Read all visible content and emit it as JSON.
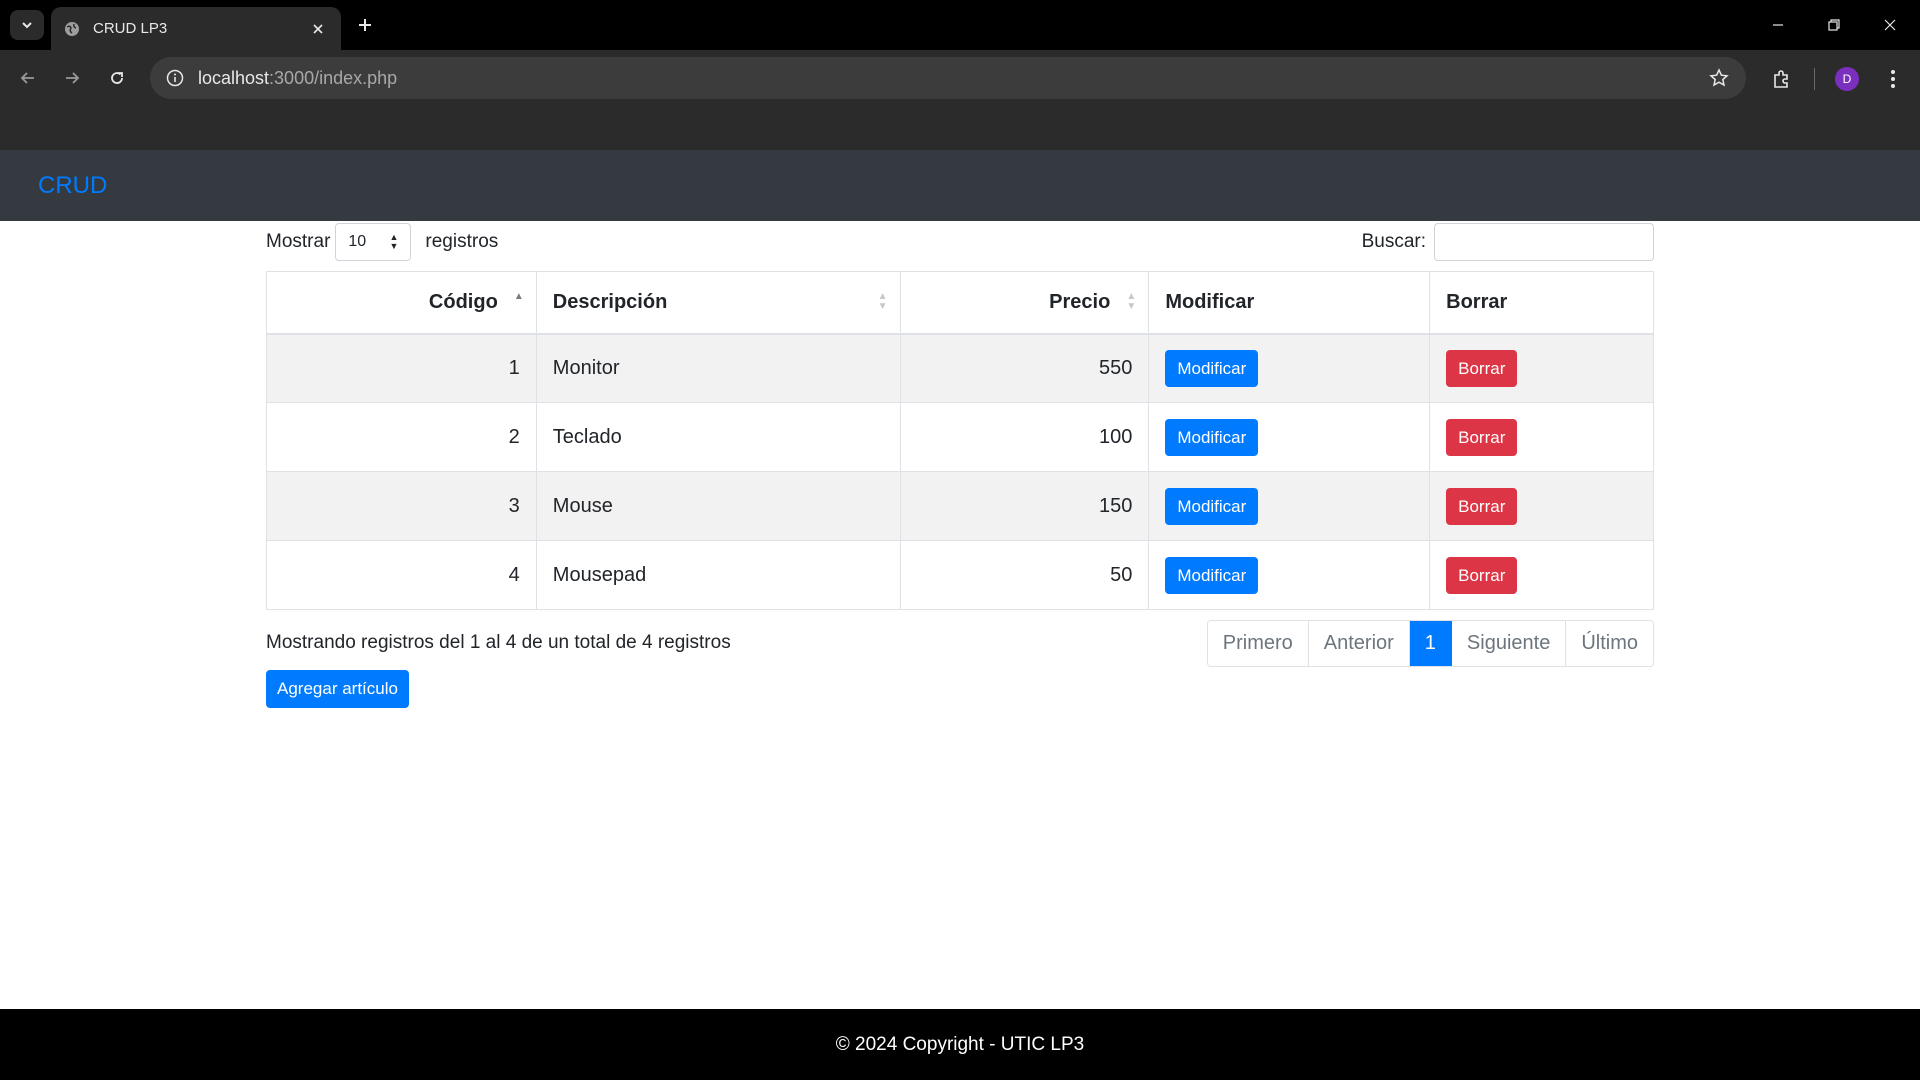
{
  "browser": {
    "tab_title": "CRUD LP3",
    "url_host": "localhost",
    "url_path": ":3000/index.php",
    "profile_initial": "D"
  },
  "navbar": {
    "brand": "CRUD"
  },
  "controls": {
    "show_label": "Mostrar",
    "page_size": "10",
    "records_label": "registros",
    "search_label": "Buscar:",
    "search_value": ""
  },
  "table": {
    "headers": {
      "codigo": "Código",
      "descripcion": "Descripción",
      "precio": "Precio",
      "modificar": "Modificar",
      "borrar": "Borrar"
    },
    "rows": [
      {
        "codigo": "1",
        "descripcion": "Monitor",
        "precio": "550",
        "modificar": "Modificar",
        "borrar": "Borrar"
      },
      {
        "codigo": "2",
        "descripcion": "Teclado",
        "precio": "100",
        "modificar": "Modificar",
        "borrar": "Borrar"
      },
      {
        "codigo": "3",
        "descripcion": "Mouse",
        "precio": "150",
        "modificar": "Modificar",
        "borrar": "Borrar"
      },
      {
        "codigo": "4",
        "descripcion": "Mousepad",
        "precio": "50",
        "modificar": "Modificar",
        "borrar": "Borrar"
      }
    ]
  },
  "info": "Mostrando registros del 1 al 4 de un total de 4 registros",
  "pagination": {
    "first": "Primero",
    "previous": "Anterior",
    "current": "1",
    "next": "Siguiente",
    "last": "Último"
  },
  "add_button": "Agregar artículo",
  "footer": "© 2024 Copyright - UTIC LP3",
  "colors": {
    "primary": "#007bff",
    "danger": "#dc3545",
    "navbar": "#343a40",
    "footer": "#000000"
  }
}
